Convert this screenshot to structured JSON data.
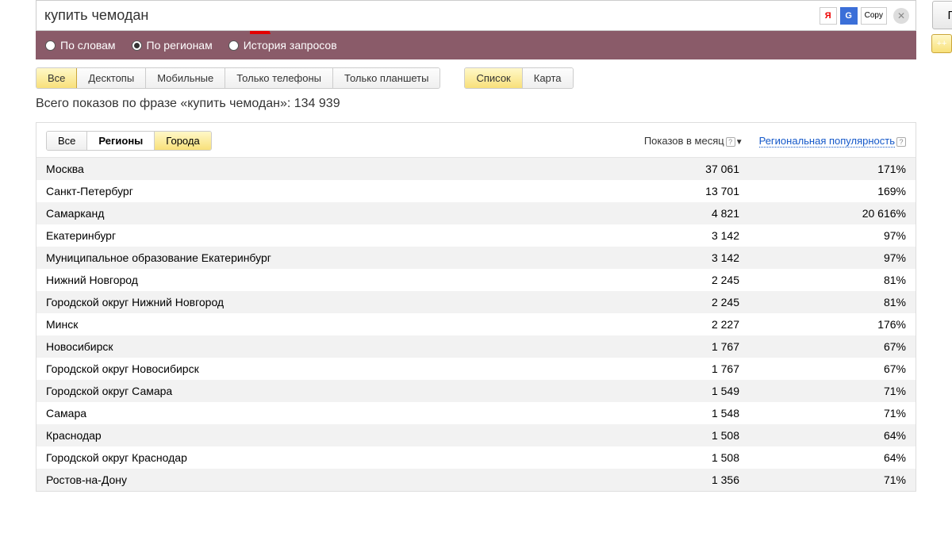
{
  "search": {
    "value": "купить чемодан",
    "copy_label": "Copy",
    "submit_label": "Подобрать"
  },
  "radios": {
    "by_words": "По словам",
    "by_regions": "По регионам",
    "history": "История запросов"
  },
  "operators": [
    "++",
    "\"\"",
    "[]",
    "!!"
  ],
  "device_tabs": [
    "Все",
    "Десктопы",
    "Мобильные",
    "Только телефоны",
    "Только планшеты"
  ],
  "view_tabs": [
    "Список",
    "Карта"
  ],
  "summary": "Всего показов по фразе «купить чемодан»: 134 939",
  "sub_tabs": [
    "Все",
    "Регионы",
    "Города"
  ],
  "columns": {
    "views": "Показов в месяц",
    "popularity": "Региональная популярность"
  },
  "rows": [
    {
      "name": "Москва",
      "views": "37 061",
      "pop": "171%"
    },
    {
      "name": "Санкт-Петербург",
      "views": "13 701",
      "pop": "169%"
    },
    {
      "name": "Самарканд",
      "views": "4 821",
      "pop": "20 616%"
    },
    {
      "name": "Екатеринбург",
      "views": "3 142",
      "pop": "97%"
    },
    {
      "name": "Муниципальное образование Екатеринбург",
      "views": "3 142",
      "pop": "97%"
    },
    {
      "name": "Нижний Новгород",
      "views": "2 245",
      "pop": "81%"
    },
    {
      "name": "Городской округ Нижний Новгород",
      "views": "2 245",
      "pop": "81%"
    },
    {
      "name": "Минск",
      "views": "2 227",
      "pop": "176%"
    },
    {
      "name": "Новосибирск",
      "views": "1 767",
      "pop": "67%"
    },
    {
      "name": "Городской округ Новосибирск",
      "views": "1 767",
      "pop": "67%"
    },
    {
      "name": "Городской округ Самара",
      "views": "1 549",
      "pop": "71%"
    },
    {
      "name": "Самара",
      "views": "1 548",
      "pop": "71%"
    },
    {
      "name": "Краснодар",
      "views": "1 508",
      "pop": "64%"
    },
    {
      "name": "Городской округ Краснодар",
      "views": "1 508",
      "pop": "64%"
    },
    {
      "name": "Ростов-на-Дону",
      "views": "1 356",
      "pop": "71%"
    }
  ]
}
